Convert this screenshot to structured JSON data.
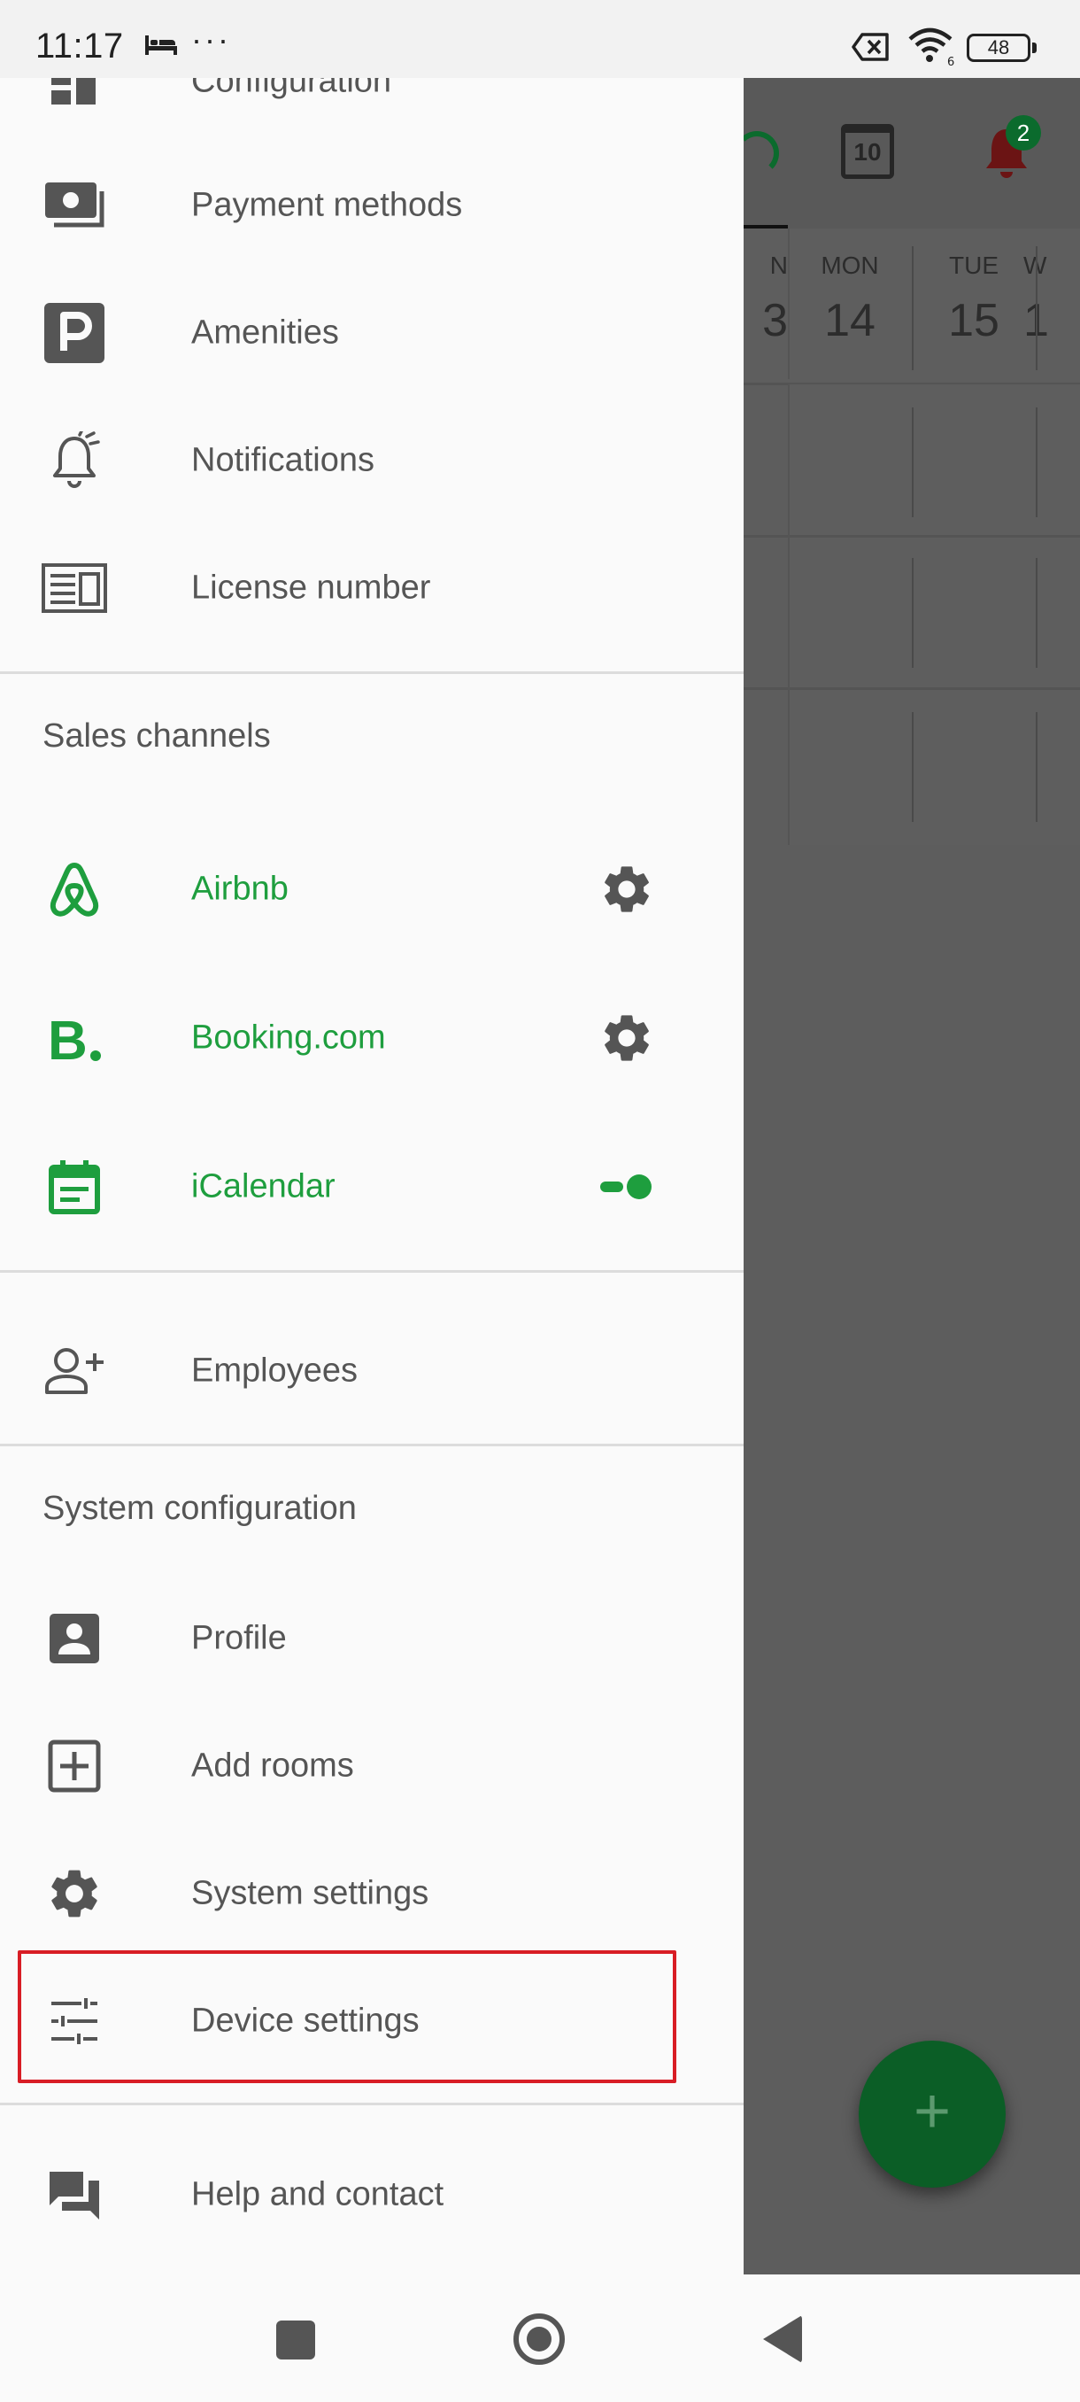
{
  "status_bar": {
    "time": "11:17",
    "dots": "···",
    "battery": "48"
  },
  "background": {
    "calendar_icon_day": "10",
    "notification_badge": "2",
    "days": [
      {
        "name": "N",
        "date": "3"
      },
      {
        "name": "MON",
        "date": "14"
      },
      {
        "name": "TUE",
        "date": "15"
      },
      {
        "name": "W",
        "date": "1"
      }
    ],
    "fab_symbol": "+"
  },
  "drawer": {
    "top_items": [
      {
        "label": "Configuration",
        "icon": "dashboard-icon"
      },
      {
        "label": "Payment methods",
        "icon": "payments-icon"
      },
      {
        "label": "Amenities",
        "icon": "parking-icon"
      },
      {
        "label": "Notifications",
        "icon": "bell-outline-icon"
      },
      {
        "label": "License number",
        "icon": "newspaper-icon"
      }
    ],
    "sales_channels": {
      "title": "Sales channels",
      "items": [
        {
          "label": "Airbnb",
          "icon": "airbnb-icon",
          "trailing": "gear-icon"
        },
        {
          "label": "Booking.com",
          "icon": "booking-icon",
          "trailing": "gear-icon"
        },
        {
          "label": "iCalendar",
          "icon": "event-note-icon",
          "trailing": "toggle-icon"
        }
      ]
    },
    "employees": {
      "label": "Employees",
      "icon": "person-add-icon"
    },
    "system_configuration": {
      "title": "System configuration",
      "items": [
        {
          "label": "Profile",
          "icon": "account-box-icon"
        },
        {
          "label": "Add rooms",
          "icon": "add-box-icon"
        },
        {
          "label": "System settings",
          "icon": "gear-icon"
        },
        {
          "label": "Device settings",
          "icon": "tune-icon"
        }
      ]
    },
    "help": {
      "label": "Help and contact",
      "icon": "forum-icon"
    }
  },
  "colors": {
    "accent_green": "#1e9e3e",
    "highlight_red": "#d81d25",
    "text_gray": "#555555"
  }
}
